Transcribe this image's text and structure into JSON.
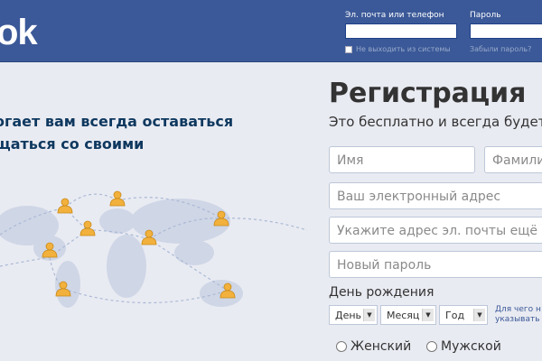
{
  "header": {
    "logo_text": "ok",
    "email_label": "Эл. почта или телефон",
    "password_label": "Пароль",
    "keep_logged_in": "Не выходить из системы",
    "forgot_password": "Забыли пароль?"
  },
  "left": {
    "tagline_line1": "огает вам всегда оставаться",
    "tagline_line2": "щаться со своими"
  },
  "signup": {
    "title": "Регистрация",
    "subtitle": "Это бесплатно и всегда будет",
    "first_name_placeholder": "Имя",
    "last_name_placeholder": "Фамили",
    "email_placeholder": "Ваш электронный адрес",
    "email_confirm_placeholder": "Укажите адрес эл. почты ещё",
    "password_placeholder": "Новый пароль",
    "birthday_label": "День рождения",
    "day_select": "День",
    "month_select": "Месяц",
    "year_select": "Год",
    "why_line1": "Для чего н",
    "why_line2": "указывать д",
    "gender_female": "Женский",
    "gender_male": "Мужской"
  },
  "colors": {
    "brand_blue": "#3b5998",
    "background": "#e9ebf2",
    "heading_navy": "#0e385f",
    "person_icon": "#f2b13c"
  }
}
